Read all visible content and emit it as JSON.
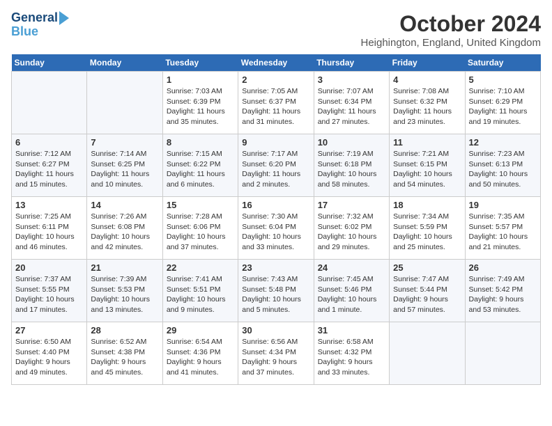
{
  "header": {
    "logo_line1": "General",
    "logo_line2": "Blue",
    "month": "October 2024",
    "location": "Heighington, England, United Kingdom"
  },
  "days_of_week": [
    "Sunday",
    "Monday",
    "Tuesday",
    "Wednesday",
    "Thursday",
    "Friday",
    "Saturday"
  ],
  "weeks": [
    [
      {
        "num": "",
        "detail": ""
      },
      {
        "num": "",
        "detail": ""
      },
      {
        "num": "1",
        "detail": "Sunrise: 7:03 AM\nSunset: 6:39 PM\nDaylight: 11 hours and 35 minutes."
      },
      {
        "num": "2",
        "detail": "Sunrise: 7:05 AM\nSunset: 6:37 PM\nDaylight: 11 hours and 31 minutes."
      },
      {
        "num": "3",
        "detail": "Sunrise: 7:07 AM\nSunset: 6:34 PM\nDaylight: 11 hours and 27 minutes."
      },
      {
        "num": "4",
        "detail": "Sunrise: 7:08 AM\nSunset: 6:32 PM\nDaylight: 11 hours and 23 minutes."
      },
      {
        "num": "5",
        "detail": "Sunrise: 7:10 AM\nSunset: 6:29 PM\nDaylight: 11 hours and 19 minutes."
      }
    ],
    [
      {
        "num": "6",
        "detail": "Sunrise: 7:12 AM\nSunset: 6:27 PM\nDaylight: 11 hours and 15 minutes."
      },
      {
        "num": "7",
        "detail": "Sunrise: 7:14 AM\nSunset: 6:25 PM\nDaylight: 11 hours and 10 minutes."
      },
      {
        "num": "8",
        "detail": "Sunrise: 7:15 AM\nSunset: 6:22 PM\nDaylight: 11 hours and 6 minutes."
      },
      {
        "num": "9",
        "detail": "Sunrise: 7:17 AM\nSunset: 6:20 PM\nDaylight: 11 hours and 2 minutes."
      },
      {
        "num": "10",
        "detail": "Sunrise: 7:19 AM\nSunset: 6:18 PM\nDaylight: 10 hours and 58 minutes."
      },
      {
        "num": "11",
        "detail": "Sunrise: 7:21 AM\nSunset: 6:15 PM\nDaylight: 10 hours and 54 minutes."
      },
      {
        "num": "12",
        "detail": "Sunrise: 7:23 AM\nSunset: 6:13 PM\nDaylight: 10 hours and 50 minutes."
      }
    ],
    [
      {
        "num": "13",
        "detail": "Sunrise: 7:25 AM\nSunset: 6:11 PM\nDaylight: 10 hours and 46 minutes."
      },
      {
        "num": "14",
        "detail": "Sunrise: 7:26 AM\nSunset: 6:08 PM\nDaylight: 10 hours and 42 minutes."
      },
      {
        "num": "15",
        "detail": "Sunrise: 7:28 AM\nSunset: 6:06 PM\nDaylight: 10 hours and 37 minutes."
      },
      {
        "num": "16",
        "detail": "Sunrise: 7:30 AM\nSunset: 6:04 PM\nDaylight: 10 hours and 33 minutes."
      },
      {
        "num": "17",
        "detail": "Sunrise: 7:32 AM\nSunset: 6:02 PM\nDaylight: 10 hours and 29 minutes."
      },
      {
        "num": "18",
        "detail": "Sunrise: 7:34 AM\nSunset: 5:59 PM\nDaylight: 10 hours and 25 minutes."
      },
      {
        "num": "19",
        "detail": "Sunrise: 7:35 AM\nSunset: 5:57 PM\nDaylight: 10 hours and 21 minutes."
      }
    ],
    [
      {
        "num": "20",
        "detail": "Sunrise: 7:37 AM\nSunset: 5:55 PM\nDaylight: 10 hours and 17 minutes."
      },
      {
        "num": "21",
        "detail": "Sunrise: 7:39 AM\nSunset: 5:53 PM\nDaylight: 10 hours and 13 minutes."
      },
      {
        "num": "22",
        "detail": "Sunrise: 7:41 AM\nSunset: 5:51 PM\nDaylight: 10 hours and 9 minutes."
      },
      {
        "num": "23",
        "detail": "Sunrise: 7:43 AM\nSunset: 5:48 PM\nDaylight: 10 hours and 5 minutes."
      },
      {
        "num": "24",
        "detail": "Sunrise: 7:45 AM\nSunset: 5:46 PM\nDaylight: 10 hours and 1 minute."
      },
      {
        "num": "25",
        "detail": "Sunrise: 7:47 AM\nSunset: 5:44 PM\nDaylight: 9 hours and 57 minutes."
      },
      {
        "num": "26",
        "detail": "Sunrise: 7:49 AM\nSunset: 5:42 PM\nDaylight: 9 hours and 53 minutes."
      }
    ],
    [
      {
        "num": "27",
        "detail": "Sunrise: 6:50 AM\nSunset: 4:40 PM\nDaylight: 9 hours and 49 minutes."
      },
      {
        "num": "28",
        "detail": "Sunrise: 6:52 AM\nSunset: 4:38 PM\nDaylight: 9 hours and 45 minutes."
      },
      {
        "num": "29",
        "detail": "Sunrise: 6:54 AM\nSunset: 4:36 PM\nDaylight: 9 hours and 41 minutes."
      },
      {
        "num": "30",
        "detail": "Sunrise: 6:56 AM\nSunset: 4:34 PM\nDaylight: 9 hours and 37 minutes."
      },
      {
        "num": "31",
        "detail": "Sunrise: 6:58 AM\nSunset: 4:32 PM\nDaylight: 9 hours and 33 minutes."
      },
      {
        "num": "",
        "detail": ""
      },
      {
        "num": "",
        "detail": ""
      }
    ]
  ]
}
